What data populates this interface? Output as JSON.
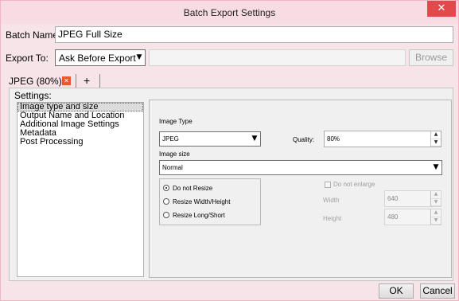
{
  "window": {
    "title": "Batch Export Settings",
    "close_glyph": "✕"
  },
  "batch_name": {
    "label": "Batch Name",
    "value": "JPEG Full Size"
  },
  "export_to": {
    "label": "Export To:",
    "selected": "Ask Before Export",
    "path_value": "",
    "browse_label": "Browse"
  },
  "tabs": {
    "active_label": "JPEG (80%)",
    "add_label": "+"
  },
  "settings": {
    "heading": "Settings:",
    "items": [
      "Image type and size",
      "Output Name and Location",
      "Additional Image Settings",
      "Metadata",
      "Post Processing"
    ]
  },
  "image_type": {
    "label": "Image Type",
    "selected": "JPEG",
    "quality_label": "Quality:",
    "quality_value": "80%"
  },
  "image_size": {
    "label": "Image size",
    "selected": "Normal"
  },
  "resize": {
    "options": [
      "Do not Resize",
      "Resize Width/Height",
      "Resize Long/Short"
    ],
    "selected_index": 0,
    "do_not_enlarge_label": "Do not enlarge",
    "width_label": "Width",
    "width_value": "640",
    "height_label": "Height",
    "height_value": "480"
  },
  "footer": {
    "ok_label": "OK",
    "cancel_label": "Cancel"
  },
  "colors": {
    "title_bg": "#f8dce4",
    "close_bg": "#e04a4a",
    "accent_tab_icon": "#e8572e"
  },
  "icons": {
    "close": "close-icon",
    "tab_close": "tab-close-icon",
    "dropdown": "chevron-down-icon",
    "spin_up": "spin-up-icon",
    "spin_down": "spin-down-icon"
  }
}
